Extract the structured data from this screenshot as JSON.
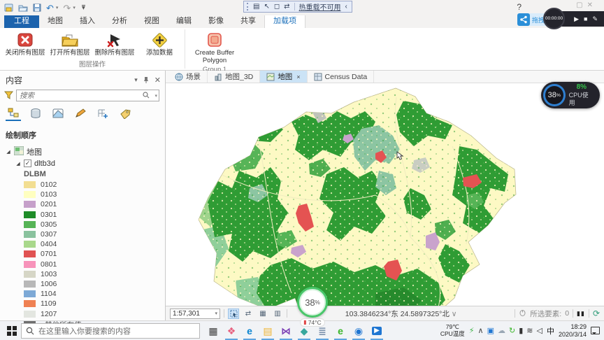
{
  "titlebar": {
    "debug_toolbar": {
      "label": "热重载不可用",
      "collapse": "‹"
    },
    "help": "?",
    "recorder": {
      "time": "00:00:00"
    },
    "upload": {
      "label": "拖拽上传"
    }
  },
  "ribbon": {
    "file_tab": "工程",
    "tabs": [
      "地图",
      "插入",
      "分析",
      "视图",
      "编辑",
      "影像",
      "共享",
      "加载项"
    ],
    "active_tab": "加载项",
    "buttons": {
      "close_all": "关闭所有图层",
      "open_all": "打开所有图层",
      "remove_all": "删除所有图层",
      "add_data": "添加数据",
      "buffer": "Create Buffer Polygon"
    },
    "group1_label": "图层操作",
    "group2_label": "Group 1"
  },
  "contents_panel": {
    "title": "内容",
    "search_placeholder": "搜索",
    "section": "绘制顺序",
    "tree": {
      "map_label": "地图",
      "layer_label": "dltb3d",
      "field_label": "DLBM",
      "check": "✓"
    },
    "legend": {
      "items": [
        {
          "code": "0102",
          "color": "#f2de92"
        },
        {
          "code": "0103",
          "color": "#ffffc0"
        },
        {
          "code": "0201",
          "color": "#c6a0ca"
        },
        {
          "code": "0301",
          "color": "#1e8c28"
        },
        {
          "code": "0305",
          "color": "#56b456"
        },
        {
          "code": "0307",
          "color": "#8ac29e"
        },
        {
          "code": "0404",
          "color": "#a9d88b"
        },
        {
          "code": "0701",
          "color": "#e05252"
        },
        {
          "code": "0801",
          "color": "#f793ba"
        },
        {
          "code": "1003",
          "color": "#d6d6c6"
        },
        {
          "code": "1006",
          "color": "#b8b8b8"
        },
        {
          "code": "1104",
          "color": "#7da9d6"
        },
        {
          "code": "1109",
          "color": "#ef8153"
        },
        {
          "code": "1207",
          "color": "#e3e6e0"
        }
      ],
      "other": {
        "code": "<其他所有值>",
        "color": "#6e6e6e"
      }
    }
  },
  "view_tabs": [
    {
      "label": "场景"
    },
    {
      "label": "地图_3D"
    },
    {
      "label": "地图",
      "close": "×"
    },
    {
      "label": "Census Data"
    }
  ],
  "map_status": {
    "scale": "1:57,301",
    "coords": "103.3846234°东 24.5897325°北",
    "coords_dd": "∨",
    "selected_label": "所选要素:",
    "selected_count": "0",
    "pause": "▮▮",
    "refresh": "⟳"
  },
  "overlays": {
    "cpu": {
      "percent": "38",
      "unit": "%",
      "usage": "8%",
      "label": "CPU使用"
    },
    "temp": {
      "percent": "38",
      "unit": "%",
      "temperature": "74°C"
    }
  },
  "taskbar": {
    "search_placeholder": "在这里输入你要搜索的内容",
    "apps": [
      {
        "name": "task-view-button",
        "glyph": "▦",
        "color": "#3d3d3d",
        "running": false
      },
      {
        "name": "pinwheel-app",
        "glyph": "❖",
        "color": "#e8617f",
        "running": true
      },
      {
        "name": "edge-browser",
        "glyph": "e",
        "color": "#0a84d0",
        "running": true
      },
      {
        "name": "file-explorer",
        "glyph": "▤",
        "color": "#f0b431",
        "running": true
      },
      {
        "name": "visual-studio",
        "glyph": "⋈",
        "color": "#7b3fb5",
        "running": true
      },
      {
        "name": "arcscene-app",
        "glyph": "◆",
        "color": "#37a79d",
        "running": true
      },
      {
        "name": "notepad-app",
        "glyph": "≣",
        "color": "#7e93ad",
        "running": true
      },
      {
        "name": "ie-browser",
        "glyph": "e",
        "color": "#3cb62b",
        "running": true
      },
      {
        "name": "arcgis-pro-app",
        "glyph": "◉",
        "color": "#1f76d2",
        "running": true
      },
      {
        "name": "video-player-app",
        "glyph": "▶",
        "color": "#ffffff",
        "bg": "#1f76d2",
        "running": true
      }
    ],
    "tray": {
      "temp": "79℃",
      "temp_label": "CPU温度",
      "icons": [
        {
          "name": "usb-icon",
          "glyph": "⚡",
          "color": "#3bb143"
        },
        {
          "name": "chevron-up-icon",
          "glyph": "∧",
          "color": "#444"
        },
        {
          "name": "display-icon",
          "glyph": "▣",
          "color": "#1f76d2"
        },
        {
          "name": "cloud-icon",
          "glyph": "☁",
          "color": "#9aa7b5"
        },
        {
          "name": "sync-icon",
          "glyph": "↻",
          "color": "#3cb62b"
        },
        {
          "name": "battery-icon",
          "glyph": "▮",
          "color": "#333333"
        },
        {
          "name": "wifi-icon",
          "glyph": "≋",
          "color": "#333333"
        },
        {
          "name": "volume-icon",
          "glyph": "◁",
          "color": "#333333"
        }
      ],
      "ime": "中",
      "time": "18:29",
      "date": "2020/3/14"
    }
  }
}
